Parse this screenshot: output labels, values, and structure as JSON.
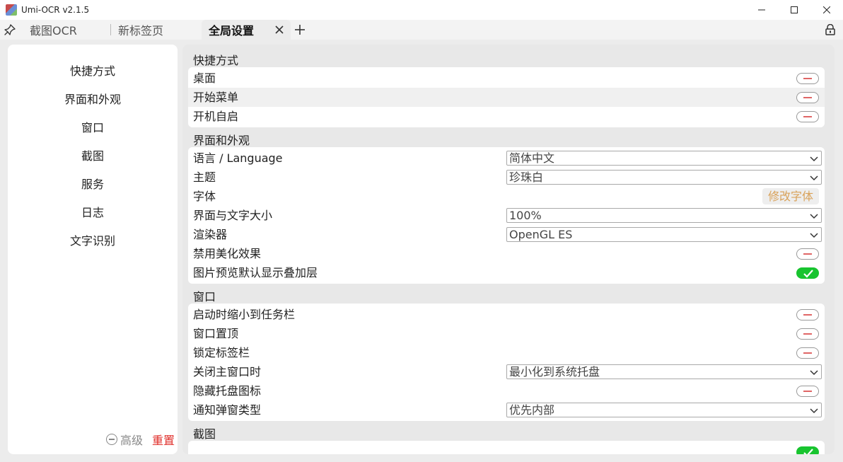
{
  "window": {
    "title": "Umi-OCR v2.1.5"
  },
  "tabs": [
    {
      "label": "截图OCR"
    },
    {
      "label": "新标签页"
    },
    {
      "label": "全局设置"
    }
  ],
  "sidebar": {
    "items": [
      {
        "label": "快捷方式"
      },
      {
        "label": "界面和外观"
      },
      {
        "label": "窗口"
      },
      {
        "label": "截图"
      },
      {
        "label": "服务"
      },
      {
        "label": "日志"
      },
      {
        "label": "文字识别"
      }
    ],
    "advanced_label": "高级",
    "reset_label": "重置"
  },
  "sections": {
    "shortcuts": {
      "title": "快捷方式",
      "rows": [
        {
          "label": "桌面",
          "value": "off"
        },
        {
          "label": "开始菜单",
          "value": "off"
        },
        {
          "label": "开机自启",
          "value": "off"
        }
      ]
    },
    "appearance": {
      "title": "界面和外观",
      "language": {
        "label": "语言 / Language",
        "value": "简体中文"
      },
      "theme": {
        "label": "主题",
        "value": "珍珠白"
      },
      "font": {
        "label": "字体",
        "button": "修改字体"
      },
      "scale": {
        "label": "界面与文字大小",
        "value": "100%"
      },
      "renderer": {
        "label": "渲染器",
        "value": "OpenGL ES"
      },
      "disable_effects": {
        "label": "禁用美化效果",
        "value": "off"
      },
      "preview_overlay": {
        "label": "图片预览默认显示叠加层",
        "value": "on"
      }
    },
    "window": {
      "title": "窗口",
      "minimize_on_start": {
        "label": "启动时缩小到任务栏",
        "value": "off"
      },
      "always_on_top": {
        "label": "窗口置顶",
        "value": "off"
      },
      "lock_tabs": {
        "label": "锁定标签栏",
        "value": "off"
      },
      "on_close": {
        "label": "关闭主窗口时",
        "value": "最小化到系统托盘"
      },
      "hide_tray": {
        "label": "隐藏托盘图标",
        "value": "off"
      },
      "notify_type": {
        "label": "通知弹窗类型",
        "value": "优先内部"
      }
    },
    "screenshot": {
      "title": "截图"
    }
  },
  "colors": {
    "switch_on": "#18c42f",
    "switch_off_mark": "#e06666",
    "reset": "#e0302c",
    "font_button_text": "#d9a25a"
  }
}
